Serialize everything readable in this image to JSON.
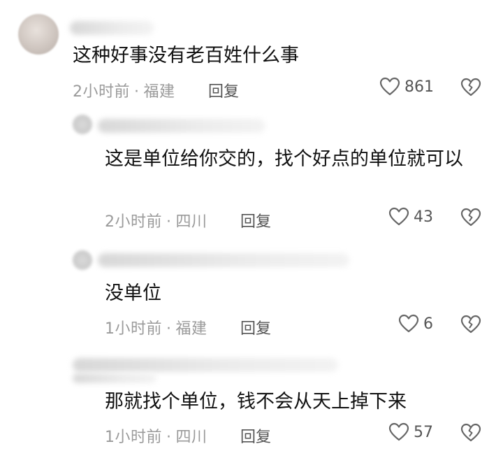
{
  "comments": [
    {
      "text": "这种好事没有老百姓什么事",
      "time": "2小时前",
      "location": "福建",
      "reply": "回复",
      "likes": "861"
    },
    {
      "text": "这是单位给你交的，找个好点的单位就可以",
      "time": "2小时前",
      "location": "四川",
      "reply": "回复",
      "likes": "43"
    },
    {
      "text": "没单位",
      "time": "1小时前",
      "location": "福建",
      "reply": "回复",
      "likes": "6"
    },
    {
      "text": "那就找个单位，钱不会从天上掉下来",
      "time": "1小时前",
      "location": "四川",
      "reply": "回复",
      "likes": "57"
    }
  ],
  "separator": "·",
  "icons": {
    "like": "heart-outline-icon",
    "dislike": "broken-heart-icon"
  }
}
